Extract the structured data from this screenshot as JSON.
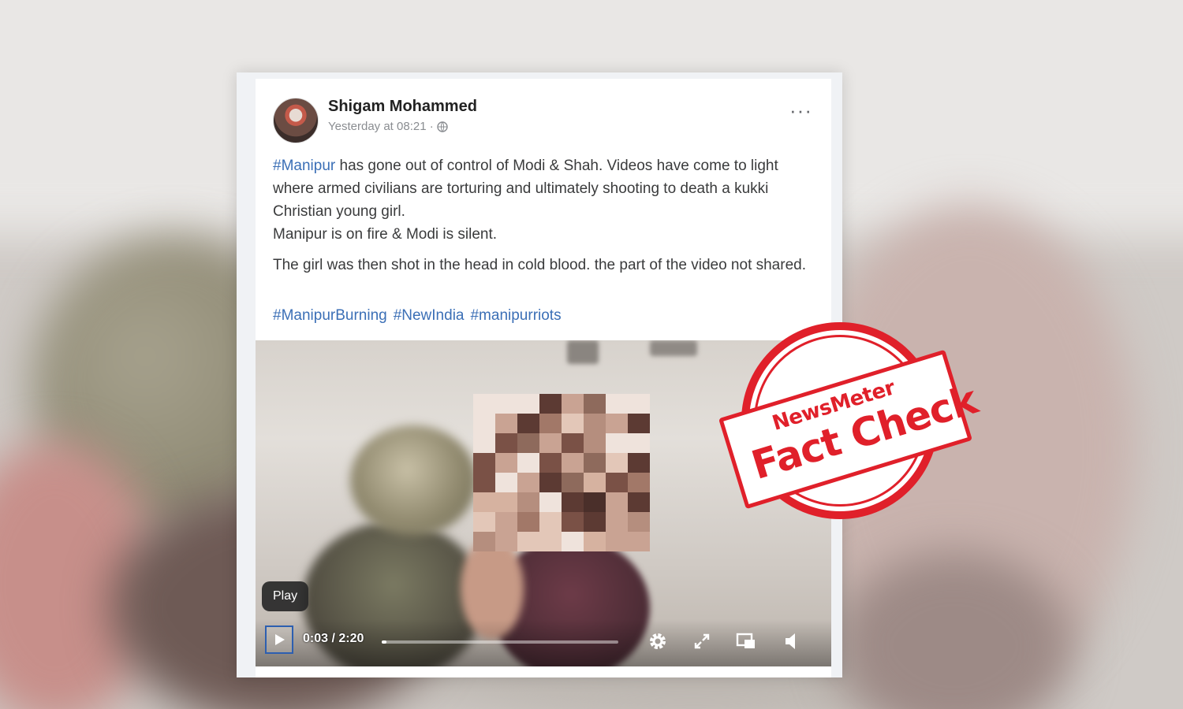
{
  "post": {
    "author": "Shigam Mohammed",
    "timestamp": "Yesterday at 08:21 ·",
    "more_icon": "···",
    "body_hashtag": "#Manipur",
    "body_line1": " has gone out of control of Modi & Shah. Videos have come to light where armed civilians are torturing and ultimately shooting to death a kukki Christian young girl.",
    "body_line2": "Manipur is on fire &  Modi is silent.",
    "body_line3": "The girl was then shot in the head in cold blood. the part of the video not shared.",
    "hashtags": [
      "#ManipurBurning",
      "#NewIndia",
      "#manipurriots"
    ]
  },
  "video": {
    "tooltip": "Play",
    "time": "0:03 / 2:20",
    "progress": 0.02,
    "icons": [
      "play-icon",
      "settings-icon",
      "fullscreen-icon",
      "picture-in-picture-icon",
      "volume-icon"
    ]
  },
  "stamp": {
    "brand": "NewsMeter",
    "label": "Fact Check",
    "color": "#e0202a"
  },
  "colors": {
    "link": "#3b6fb6",
    "stamp_red": "#e0202a"
  }
}
